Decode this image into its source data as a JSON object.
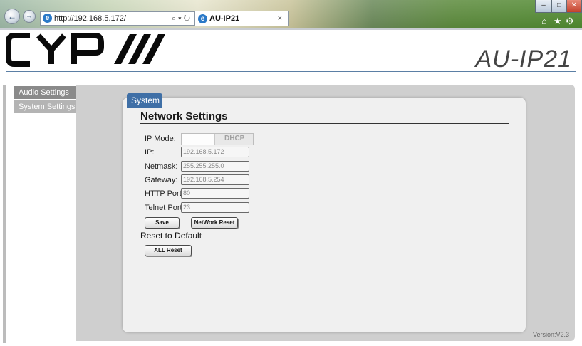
{
  "browser": {
    "address_url": "http://192.168.5.172/",
    "address_tools": "⌕ ▾ ↻",
    "tab_title": "AU-IP21",
    "tab_close": "×",
    "back_icon": "back-arrow-icon",
    "forward_icon": "forward-arrow-icon",
    "home_glyph": "⌂",
    "favorites_glyph": "★",
    "settings_glyph": "⚙",
    "minimize_glyph": "‒",
    "maximize_glyph": "□",
    "close_glyph": "✕"
  },
  "header": {
    "logo_text": "CYP",
    "model": "AU-IP21"
  },
  "sidebar": {
    "items": [
      {
        "label": "Audio Settings",
        "state": "active"
      },
      {
        "label": "System Settings",
        "state": "idle"
      }
    ]
  },
  "panel": {
    "tab_label": "System",
    "section_title": "Network Settings",
    "fields": {
      "ip_mode_label": "IP Mode:",
      "ip_mode_value": "DHCP",
      "ip_label": "IP:",
      "ip_value": "192.168.5.172",
      "netmask_label": "Netmask:",
      "netmask_value": "255.255.255.0",
      "gateway_label": "Gateway:",
      "gateway_value": "192.168.5.254",
      "http_port_label": "HTTP Port:",
      "http_port_value": "80",
      "telnet_port_label": "Telnet Port:",
      "telnet_port_value": "23"
    },
    "buttons": {
      "save": "Save",
      "network_reset": "NetWork Reset",
      "all_reset": "ALL Reset"
    },
    "reset_title": "Reset to Default"
  },
  "footer": {
    "version": "Version:V2.3"
  },
  "colors": {
    "accent": "#3f6fa6",
    "sidebar_active": "#8a8a8a",
    "sidebar_idle": "#b4b4b4",
    "content_bg": "#cfcfcf",
    "panel_bg": "#f0f0f0"
  }
}
